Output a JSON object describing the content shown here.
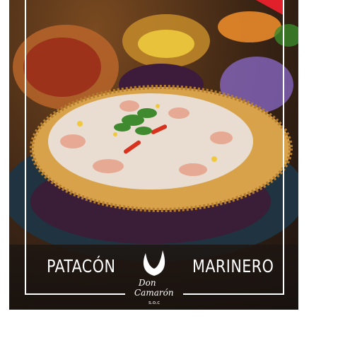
{
  "title": {
    "left": "PATACÓN",
    "right": "MARINERO"
  },
  "logo": {
    "line1": "Don",
    "line2": "Camarón",
    "mark": "s.o.c"
  },
  "colors": {
    "accent_red": "#e0202a",
    "frame": "#ffffff",
    "banner": "#1e1612",
    "patacon": "#d8a24a"
  }
}
